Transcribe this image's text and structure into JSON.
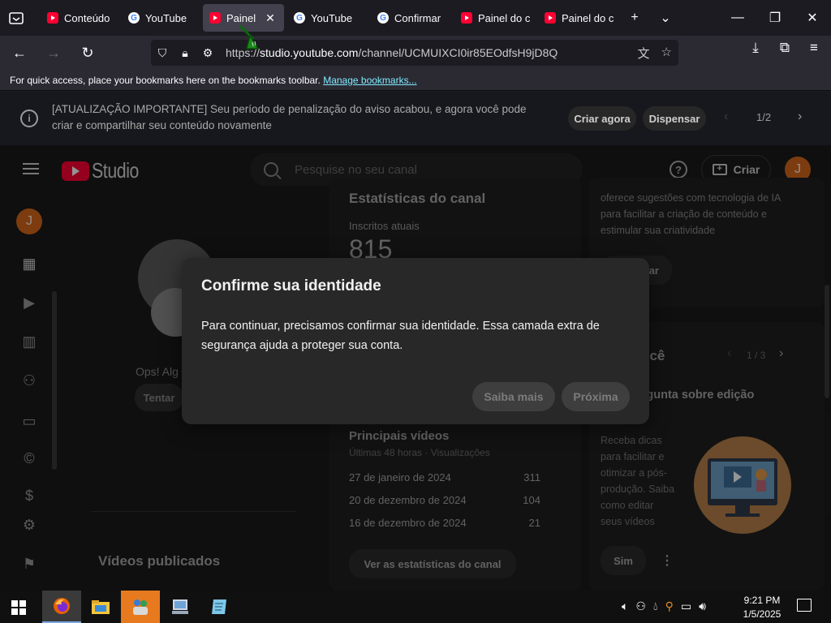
{
  "browser": {
    "tabs": [
      {
        "label": "Conteúdo",
        "favicon": "youtube"
      },
      {
        "label": "YouTube",
        "favicon": "google"
      },
      {
        "label": "Painel",
        "favicon": "youtube",
        "active": true
      },
      {
        "label": "YouTube",
        "favicon": "google"
      },
      {
        "label": "Confirmar",
        "favicon": "google"
      },
      {
        "label": "Painel do c",
        "favicon": "youtube"
      },
      {
        "label": "Painel do c",
        "favicon": "youtube"
      }
    ],
    "url_prefix": "https://",
    "url_domain": "studio.youtube.com",
    "url_path": "/channel/UCMUIXCI0ir85EOdfsH9jD8Q",
    "bookmarks_text": "For quick access, place your bookmarks here on the bookmarks toolbar.",
    "bookmarks_link": "Manage bookmarks..."
  },
  "notice": {
    "text": "[ATUALIZAÇÃO IMPORTANTE] Seu período de penalização do aviso acabou, e agora você pode criar e compartilhar seu conteúdo novamente",
    "create_now": "Criar agora",
    "dismiss": "Dispensar",
    "counter": "1/2"
  },
  "studio": {
    "logo_text": "Studio",
    "search_placeholder": "Pesquise no seu canal",
    "create_label": "Criar",
    "avatar_letter": "J",
    "channel_stats": {
      "title": "Estatísticas do canal",
      "subs_label": "Inscritos atuais",
      "subs_value": "815"
    },
    "top_videos": {
      "title": "Principais vídeos",
      "subtitle": "Últimas 48 horas · Visualizações",
      "rows": [
        {
          "date": "27 de janeiro de 2024",
          "views": "311"
        },
        {
          "date": "20 de dezembro de 2024",
          "views": "104"
        },
        {
          "date": "16 de dezembro de 2024",
          "views": "21"
        }
      ],
      "button": "Ver as estatísticas do canal"
    },
    "ai_card": {
      "text1": "oferece sugestões com tecnologia de IA",
      "text2": "para facilitar a criação de conteúdo e",
      "text3": "estimular sua criatividade",
      "button_partial": "rar"
    },
    "for_you": {
      "title_partial": "para você",
      "counter": "1 / 3",
      "question_partial": "uma pergunta sobre edição",
      "tip_lines": [
        "Receba dicas",
        "para facilitar e",
        "otimizar a pós-",
        "produção. Saiba",
        "como editar",
        "seus vídeos"
      ],
      "yes": "Sim"
    },
    "left_panel": {
      "oops": "Ops! Alg",
      "retry": "Tentar",
      "published": "Vídeos publicados"
    }
  },
  "modal": {
    "title": "Confirme sua identidade",
    "body": "Para continuar, precisamos confirmar sua identidade. Essa camada extra de segurança ajuda a proteger sua conta.",
    "learn_more": "Saiba mais",
    "next": "Próxima"
  },
  "taskbar": {
    "time": "9:21 PM",
    "date": "1/5/2025"
  }
}
